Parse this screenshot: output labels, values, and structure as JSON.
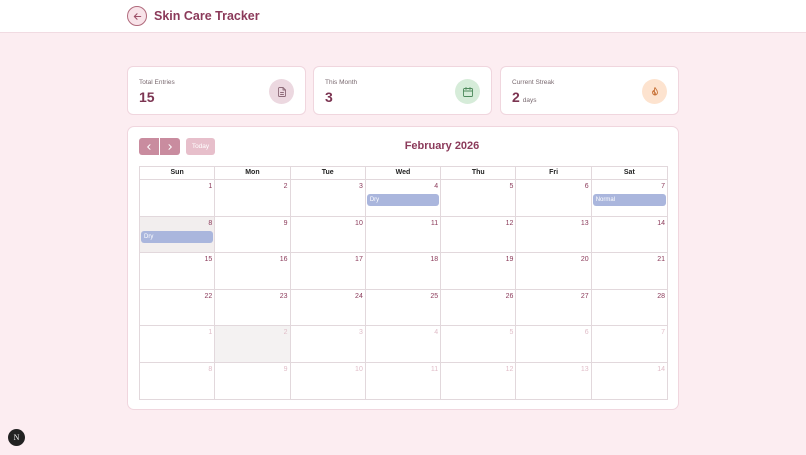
{
  "header": {
    "title": "Skin Care Tracker",
    "back_icon": "arrow-left-icon"
  },
  "stats": [
    {
      "label": "Total Entries",
      "value": "15",
      "unit": "",
      "icon": "document-icon",
      "color": "#ecd8e0"
    },
    {
      "label": "This Month",
      "value": "3",
      "unit": "",
      "icon": "calendar-icon",
      "color": "#d6ecd9"
    },
    {
      "label": "Current Streak",
      "value": "2",
      "unit": "days",
      "icon": "flame-icon",
      "color": "#fde3cf"
    }
  ],
  "calendar": {
    "month_label": "February 2026",
    "today_label": "Today",
    "days_of_week": [
      "Sun",
      "Mon",
      "Tue",
      "Wed",
      "Thu",
      "Fri",
      "Sat"
    ],
    "weeks": [
      [
        {
          "d": "1",
          "cur": true
        },
        {
          "d": "2",
          "cur": true
        },
        {
          "d": "3",
          "cur": true
        },
        {
          "d": "4",
          "cur": true,
          "entry": "Dry"
        },
        {
          "d": "5",
          "cur": true
        },
        {
          "d": "6",
          "cur": true
        },
        {
          "d": "7",
          "cur": true,
          "entry": "Normal"
        }
      ],
      [
        {
          "d": "8",
          "cur": true,
          "entry": "Dry",
          "selected": true
        },
        {
          "d": "9",
          "cur": true
        },
        {
          "d": "10",
          "cur": true
        },
        {
          "d": "11",
          "cur": true
        },
        {
          "d": "12",
          "cur": true
        },
        {
          "d": "13",
          "cur": true
        },
        {
          "d": "14",
          "cur": true
        }
      ],
      [
        {
          "d": "15",
          "cur": true
        },
        {
          "d": "16",
          "cur": true
        },
        {
          "d": "17",
          "cur": true
        },
        {
          "d": "18",
          "cur": true
        },
        {
          "d": "19",
          "cur": true
        },
        {
          "d": "20",
          "cur": true
        },
        {
          "d": "21",
          "cur": true
        }
      ],
      [
        {
          "d": "22",
          "cur": true
        },
        {
          "d": "23",
          "cur": true
        },
        {
          "d": "24",
          "cur": true
        },
        {
          "d": "25",
          "cur": true
        },
        {
          "d": "26",
          "cur": true
        },
        {
          "d": "27",
          "cur": true
        },
        {
          "d": "28",
          "cur": true
        }
      ],
      [
        {
          "d": "1",
          "cur": false
        },
        {
          "d": "2",
          "cur": false,
          "today": true
        },
        {
          "d": "3",
          "cur": false
        },
        {
          "d": "4",
          "cur": false
        },
        {
          "d": "5",
          "cur": false
        },
        {
          "d": "6",
          "cur": false
        },
        {
          "d": "7",
          "cur": false
        }
      ],
      [
        {
          "d": "8",
          "cur": false
        },
        {
          "d": "9",
          "cur": false
        },
        {
          "d": "10",
          "cur": false
        },
        {
          "d": "11",
          "cur": false
        },
        {
          "d": "12",
          "cur": false
        },
        {
          "d": "13",
          "cur": false
        },
        {
          "d": "14",
          "cur": false
        }
      ]
    ]
  },
  "dev_badge": "N"
}
